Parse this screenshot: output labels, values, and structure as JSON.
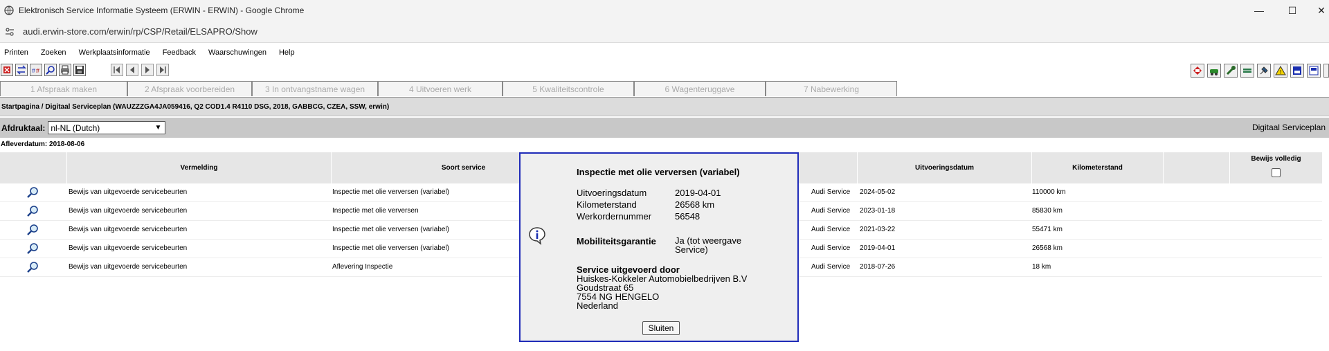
{
  "window": {
    "title": "Elektronisch Service Informatie Systeem (ERWIN - ERWIN) - Google Chrome",
    "url": "audi.erwin-store.com/erwin/rp/CSP/Retail/ELSAPRO/Show",
    "minimize": "—",
    "maximize": "☐",
    "close": "✕"
  },
  "menu": [
    "Printen",
    "Zoeken",
    "Werkplaatsinformatie",
    "Feedback",
    "Waarschuwingen",
    "Help"
  ],
  "steps": [
    "1 Afspraak maken",
    "2 Afspraak voorbereiden",
    "3 In ontvangstname wagen",
    "4 Uitvoeren werk",
    "5 Kwaliteitscontrole",
    "6 Wagenteruggave",
    "7 Nabewerking"
  ],
  "breadcrumb": "Startpagina / Digitaal Serviceplan (WAUZZZGA4JA059416, Q2 COD1.4 R4110 DSG, 2018, GABBCG, CZEA, SSW, erwin)",
  "print": {
    "label": "Afdruktaal:",
    "language": "nl-NL (Dutch)",
    "display": "Digitaal Serviceplan"
  },
  "delivery_date": "Afleverdatum: 2018-08-06",
  "table": {
    "headers": {
      "vermelding": "Vermelding",
      "soort": "Soort service",
      "uitvoeringsdatum": "Uitvoeringsdatum",
      "kilometerstand": "Kilometerstand",
      "bewijs": "Bewijs volledig"
    },
    "rows": [
      {
        "vermelding": "Bewijs van uitgevoerde servicebeurten",
        "soort": "Inspectie met olie verversen (variabel)",
        "service": "Audi Service",
        "datum": "2024-05-02",
        "km": "110000 km"
      },
      {
        "vermelding": "Bewijs van uitgevoerde servicebeurten",
        "soort": "Inspectie met olie verversen",
        "service": "Audi Service",
        "datum": "2023-01-18",
        "km": "85830 km"
      },
      {
        "vermelding": "Bewijs van uitgevoerde servicebeurten",
        "soort": "Inspectie met olie verversen (variabel)",
        "service": "Audi Service",
        "datum": "2021-03-22",
        "km": "55471 km"
      },
      {
        "vermelding": "Bewijs van uitgevoerde servicebeurten",
        "soort": "Inspectie met olie verversen (variabel)",
        "service": "Audi Service",
        "datum": "2019-04-01",
        "km": "26568 km"
      },
      {
        "vermelding": "Bewijs van uitgevoerde servicebeurten",
        "soort": "Aflevering Inspectie",
        "service": "Audi Service",
        "datum": "2018-07-26",
        "km": "18 km"
      }
    ]
  },
  "modal": {
    "title": "Inspectie met olie verversen (variabel)",
    "date_label": "Uitvoeringsdatum",
    "date_value": "2019-04-01",
    "km_label": "Kilometerstand",
    "km_value": "26568 km",
    "order_label": "Werkordernummer",
    "order_value": "56548",
    "mobility_label": "Mobiliteitsgarantie",
    "mobility_value_1": "Ja (tot weergave",
    "mobility_value_2": "Service)",
    "performed_label": "Service uitgevoerd door",
    "address": [
      "Huiskes-Kokkeler Automobielbedrijven B.V",
      "Goudstraat 65",
      "7554 NG HENGELO",
      "Nederland"
    ],
    "close_label": "Sluiten"
  },
  "colors": {
    "modal_border": "#1f2bb8",
    "header_bg": "#e6e6e6",
    "print_bar": "#c8c8c8"
  }
}
